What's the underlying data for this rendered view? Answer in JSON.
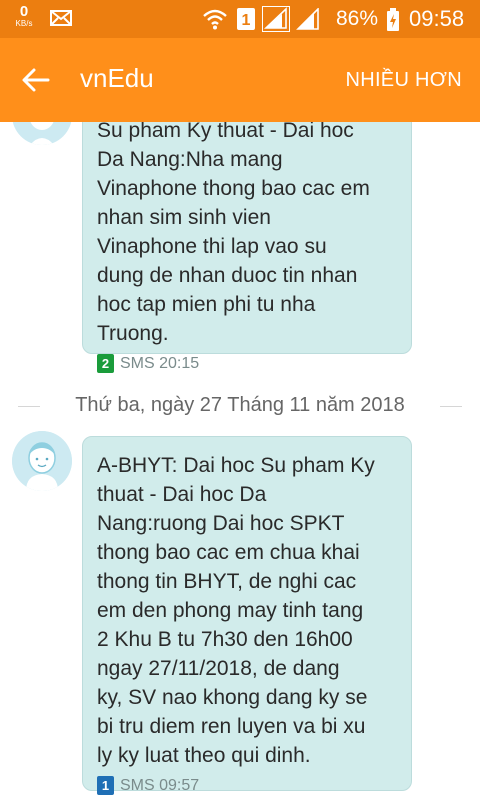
{
  "status_bar": {
    "speed_value": "0",
    "speed_unit": "KB/s",
    "sim_slot": "1",
    "battery": "86%",
    "time": "09:58"
  },
  "app_bar": {
    "title": "vnEdu",
    "more_label": "NHIỀU HƠN"
  },
  "messages": [
    {
      "text": "Su pham Ky thuat - Dai hoc\nDa Nang:Nha mang\nVinaphone thong bao cac em\nnhan sim sinh vien\nVinaphone thi lap vao su\ndung de nhan duoc tin nhan\nhoc tap mien phi tu nha\nTruong.",
      "sim": "2",
      "sim_color": "#1a9c3b",
      "meta": "SMS 20:15"
    },
    {
      "text": "A-BHYT: Dai hoc Su pham Ky\nthuat - Dai hoc Da\nNang:ruong Dai hoc SPKT\nthong bao cac em chua khai\nthong tin BHYT, de nghi cac\nem den phong may tinh tang\n2 Khu B tu 7h30 den 16h00\nngay 27/11/2018, de dang\nky, SV nao khong dang ky se\nbi tru diem ren luyen va bi xu\nly ky luat theo qui dinh.",
      "sim": "1",
      "sim_color": "#1f6fb5",
      "meta": "SMS 09:57"
    }
  ],
  "date_separator": "Thứ ba, ngày 27 Tháng 11 năm 2018",
  "colors": {
    "status_bar": "#ec7e10",
    "app_bar": "#ff8f1a",
    "bubble": "#d1eceb"
  },
  "icons": [
    "mail-icon",
    "wifi-icon",
    "signal-icon",
    "battery-icon",
    "back-arrow-icon",
    "avatar-icon"
  ]
}
